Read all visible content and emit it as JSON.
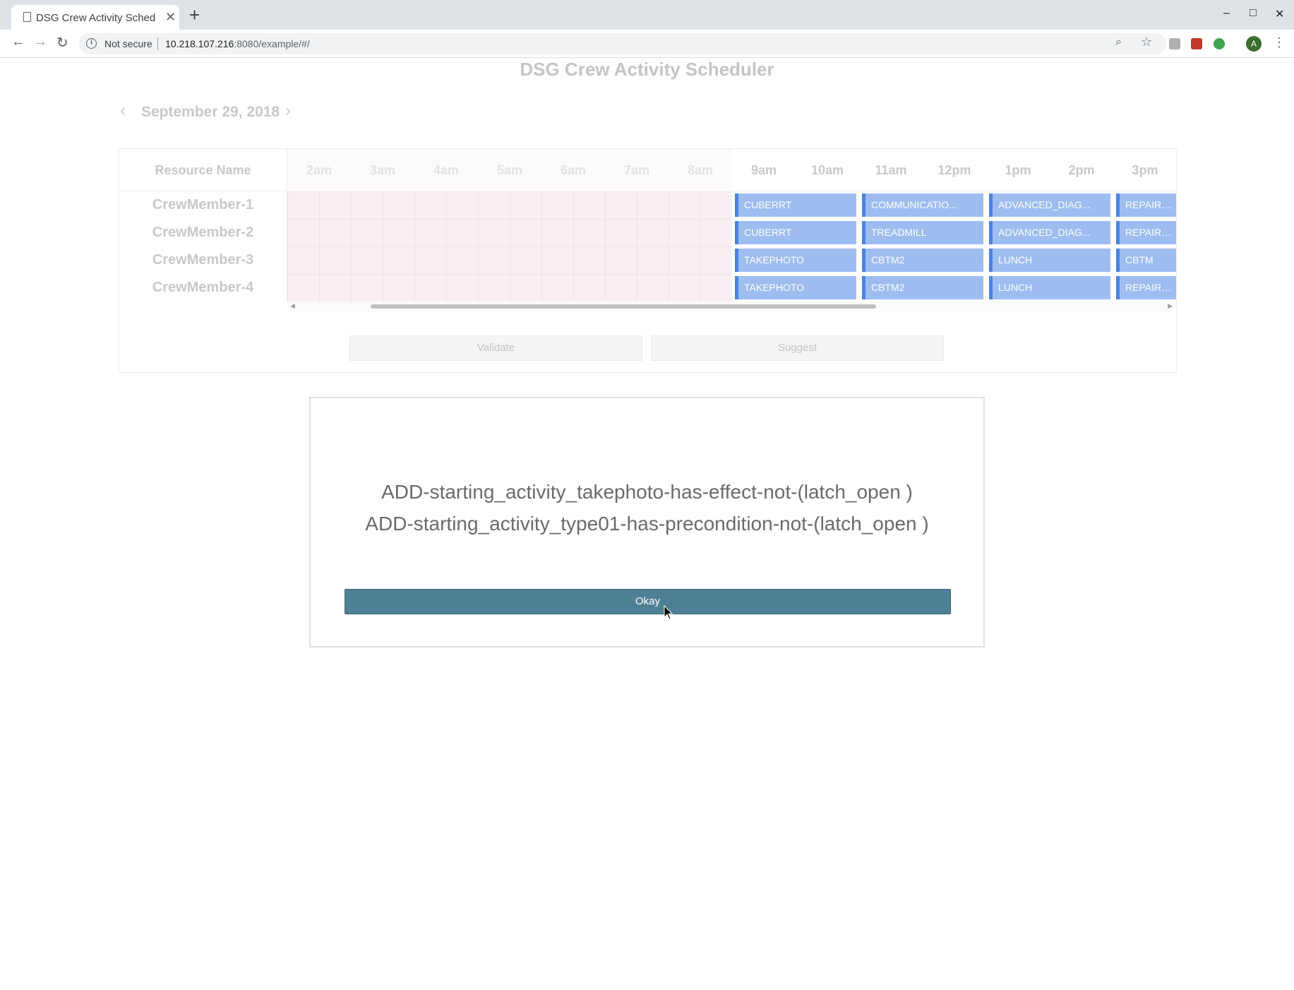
{
  "browser": {
    "tab_title": "DSG Crew Activity Schedu",
    "tab_close": "✕",
    "new_tab": "+",
    "security_label": "Not secure",
    "url_host": "10.218.107.216",
    "url_rest": ":8080/example/#/",
    "avatar_letter": "A",
    "window_controls": [
      "–",
      "□",
      "✕"
    ]
  },
  "app": {
    "title": "DSG Crew Activity Scheduler",
    "date": "September 29, 2018",
    "prev_icon": "‹",
    "next_icon": "›"
  },
  "scheduler": {
    "resource_header": "Resource Name",
    "hours": [
      {
        "label": "2am",
        "off": true
      },
      {
        "label": "3am",
        "off": true
      },
      {
        "label": "4am",
        "off": true
      },
      {
        "label": "5am",
        "off": true
      },
      {
        "label": "6am",
        "off": true
      },
      {
        "label": "7am",
        "off": true
      },
      {
        "label": "8am",
        "off": true
      },
      {
        "label": "9am",
        "off": false
      },
      {
        "label": "10am",
        "off": false
      },
      {
        "label": "11am",
        "off": false
      },
      {
        "label": "12pm",
        "off": false
      },
      {
        "label": "1pm",
        "off": false
      },
      {
        "label": "2pm",
        "off": false
      },
      {
        "label": "3pm",
        "off": false
      }
    ],
    "rows": [
      {
        "name": "CrewMember-1",
        "events": [
          "CUBERRT",
          "COMMUNICATIO...",
          "ADVANCED_DIAG...",
          "REPAIRSHU"
        ]
      },
      {
        "name": "CrewMember-2",
        "events": [
          "CUBERRT",
          "TREADMILL",
          "ADVANCED_DIAG...",
          "REPAIRSHU"
        ]
      },
      {
        "name": "CrewMember-3",
        "events": [
          "TAKEPHOTO",
          "CBTM2",
          "LUNCH",
          "CBTM"
        ]
      },
      {
        "name": "CrewMember-4",
        "events": [
          "TAKEPHOTO",
          "CBTM2",
          "LUNCH",
          "REPAIRSHU"
        ]
      }
    ]
  },
  "actions": {
    "validate": "Validate",
    "suggest": "Suggest"
  },
  "modal": {
    "line1": "ADD-starting_activity_takephoto-has-effect-not-(latch_open )",
    "line2": "ADD-starting_activity_type01-has-precondition-not-(latch_open )",
    "ok_label": "Okay"
  },
  "colors": {
    "event_fill": "#9dbdf0",
    "event_border": "#4a84e0",
    "okay_button": "#4f7f94",
    "offhours_fill": "#f9eef2"
  }
}
